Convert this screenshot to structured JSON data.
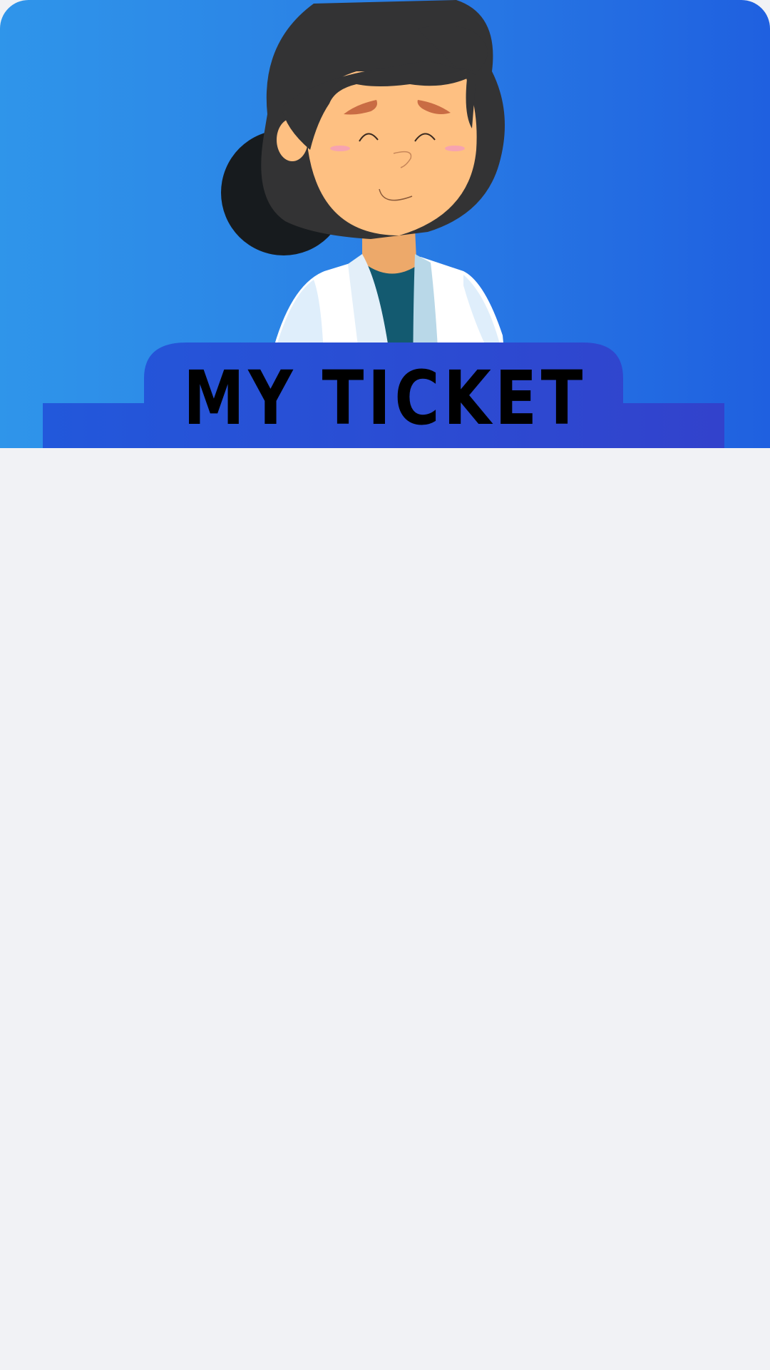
{
  "header": {
    "title": "MY TICKET",
    "illustration": "doctor-avatar-illustration"
  },
  "colors": {
    "hero_start": "#2f95ea",
    "hero_end": "#1f60e0",
    "title_plate": "#2b4fd6",
    "page_background": "#f1f2f5"
  }
}
